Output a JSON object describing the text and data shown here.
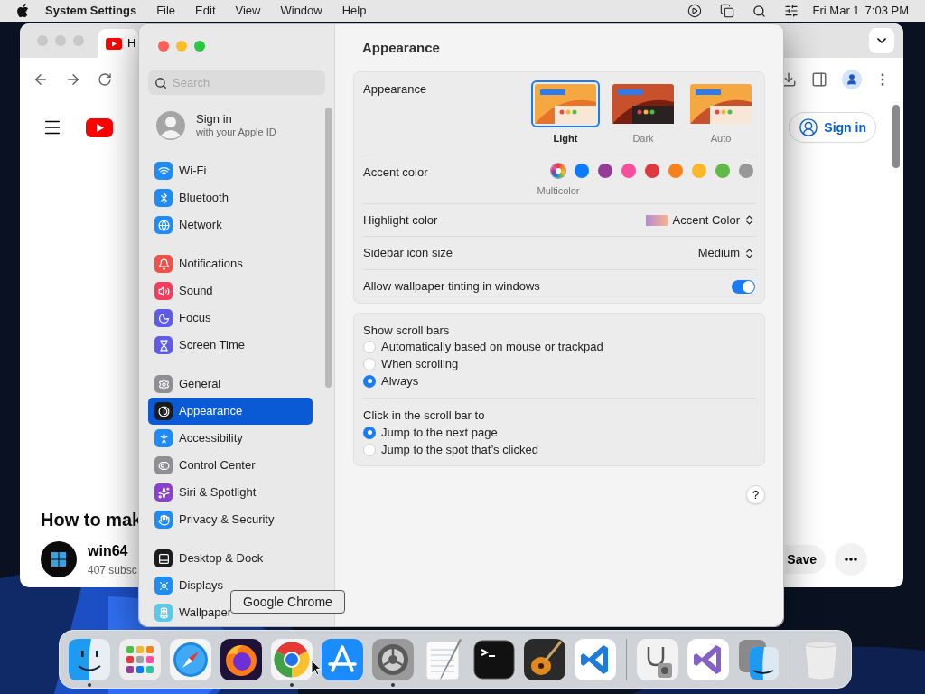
{
  "menu_bar": {
    "app_name": "System Settings",
    "menus": [
      "File",
      "Edit",
      "View",
      "Window",
      "Help"
    ],
    "date": "Fri Mar 1",
    "time": "7:03 PM"
  },
  "browser": {
    "tab_title": "H",
    "sign_in": "Sign in",
    "video_title": "How to mak",
    "channel_name": "win64",
    "subscribers": "407 subsc",
    "save": "Save"
  },
  "settings": {
    "search": {
      "placeholder": "Search"
    },
    "account": {
      "title": "Sign in",
      "subtitle": "with your Apple ID"
    },
    "sidebar_groups": [
      [
        {
          "label": "Wi-Fi",
          "selected": false,
          "color": "#1f8cf5"
        },
        {
          "label": "Bluetooth",
          "selected": false,
          "color": "#1f8cf5"
        },
        {
          "label": "Network",
          "selected": false,
          "color": "#1f8cf5"
        }
      ],
      [
        {
          "label": "Notifications",
          "selected": false,
          "color": "#f2514a"
        },
        {
          "label": "Sound",
          "selected": false,
          "color": "#f23d5f"
        },
        {
          "label": "Focus",
          "selected": false,
          "color": "#5e5ce6"
        },
        {
          "label": "Screen Time",
          "selected": false,
          "color": "#5e5ce6"
        }
      ],
      [
        {
          "label": "General",
          "selected": false,
          "color": "#8e8e93"
        },
        {
          "label": "Appearance",
          "selected": true,
          "color": "#1c1c1e"
        },
        {
          "label": "Accessibility",
          "selected": false,
          "color": "#1f8cf5"
        },
        {
          "label": "Control Center",
          "selected": false,
          "color": "#8e8e93"
        },
        {
          "label": "Siri & Spotlight",
          "selected": false,
          "color": "#8a3fd1"
        },
        {
          "label": "Privacy & Security",
          "selected": false,
          "color": "#1f8cf5"
        }
      ],
      [
        {
          "label": "Desktop & Dock",
          "selected": false,
          "color": "#1c1c1e"
        },
        {
          "label": "Displays",
          "selected": false,
          "color": "#1f8cf5"
        },
        {
          "label": "Wallpaper",
          "selected": false,
          "color": "#5ac8e6"
        }
      ]
    ],
    "page_title": "Appearance",
    "appearance": {
      "label": "Appearance",
      "options": [
        {
          "kind": "light",
          "label": "Light",
          "selected": true
        },
        {
          "kind": "dark",
          "label": "Dark",
          "selected": false
        },
        {
          "kind": "auto",
          "label": "Auto",
          "selected": false
        }
      ]
    },
    "accent": {
      "label": "Accent color",
      "caption": "Multicolor",
      "swatches": [
        {
          "kind": "multicolor",
          "selected": true
        },
        {
          "kind": "solid",
          "color": "#0a7aff",
          "selected": false
        },
        {
          "kind": "solid",
          "color": "#953d96",
          "selected": false
        },
        {
          "kind": "solid",
          "color": "#f74f9e",
          "selected": false
        },
        {
          "kind": "solid",
          "color": "#e0383e",
          "selected": false
        },
        {
          "kind": "solid",
          "color": "#f7821b",
          "selected": false
        },
        {
          "kind": "solid",
          "color": "#fcb827",
          "selected": false
        },
        {
          "kind": "solid",
          "color": "#62ba46",
          "selected": false
        },
        {
          "kind": "solid",
          "color": "#989898",
          "selected": false
        }
      ]
    },
    "highlight": {
      "label": "Highlight color",
      "value": "Accent Color"
    },
    "icon_size": {
      "label": "Sidebar icon size",
      "value": "Medium"
    },
    "tinting": {
      "label": "Allow wallpaper tinting in windows",
      "on": true
    },
    "scroll_bars": {
      "label": "Show scroll bars",
      "options": [
        {
          "label": "Automatically based on mouse or trackpad",
          "selected": false
        },
        {
          "label": "When scrolling",
          "selected": false
        },
        {
          "label": "Always",
          "selected": true
        }
      ]
    },
    "click_scroll": {
      "label": "Click in the scroll bar to",
      "options": [
        {
          "label": "Jump to the next page",
          "selected": true
        },
        {
          "label": "Jump to the spot that’s clicked",
          "selected": false
        }
      ]
    },
    "help": "?"
  },
  "tooltip": "Google Chrome",
  "dock": {
    "groups": [
      [
        {
          "kind": "finder",
          "running": true
        },
        {
          "kind": "launchpad",
          "running": false
        },
        {
          "kind": "safari",
          "running": false
        },
        {
          "kind": "firefox",
          "running": false
        },
        {
          "kind": "chrome",
          "running": true
        },
        {
          "kind": "appstore",
          "running": false
        },
        {
          "kind": "settings",
          "running": true
        },
        {
          "kind": "textedit",
          "running": false
        },
        {
          "kind": "terminal",
          "running": false
        },
        {
          "kind": "garageband",
          "running": false
        },
        {
          "kind": "vscode",
          "running": false
        }
      ],
      [
        {
          "kind": "diskutility",
          "running": false
        },
        {
          "kind": "visualstudio",
          "running": false
        },
        {
          "kind": "migration",
          "running": false
        }
      ],
      [
        {
          "kind": "trash",
          "running": false
        }
      ]
    ]
  }
}
